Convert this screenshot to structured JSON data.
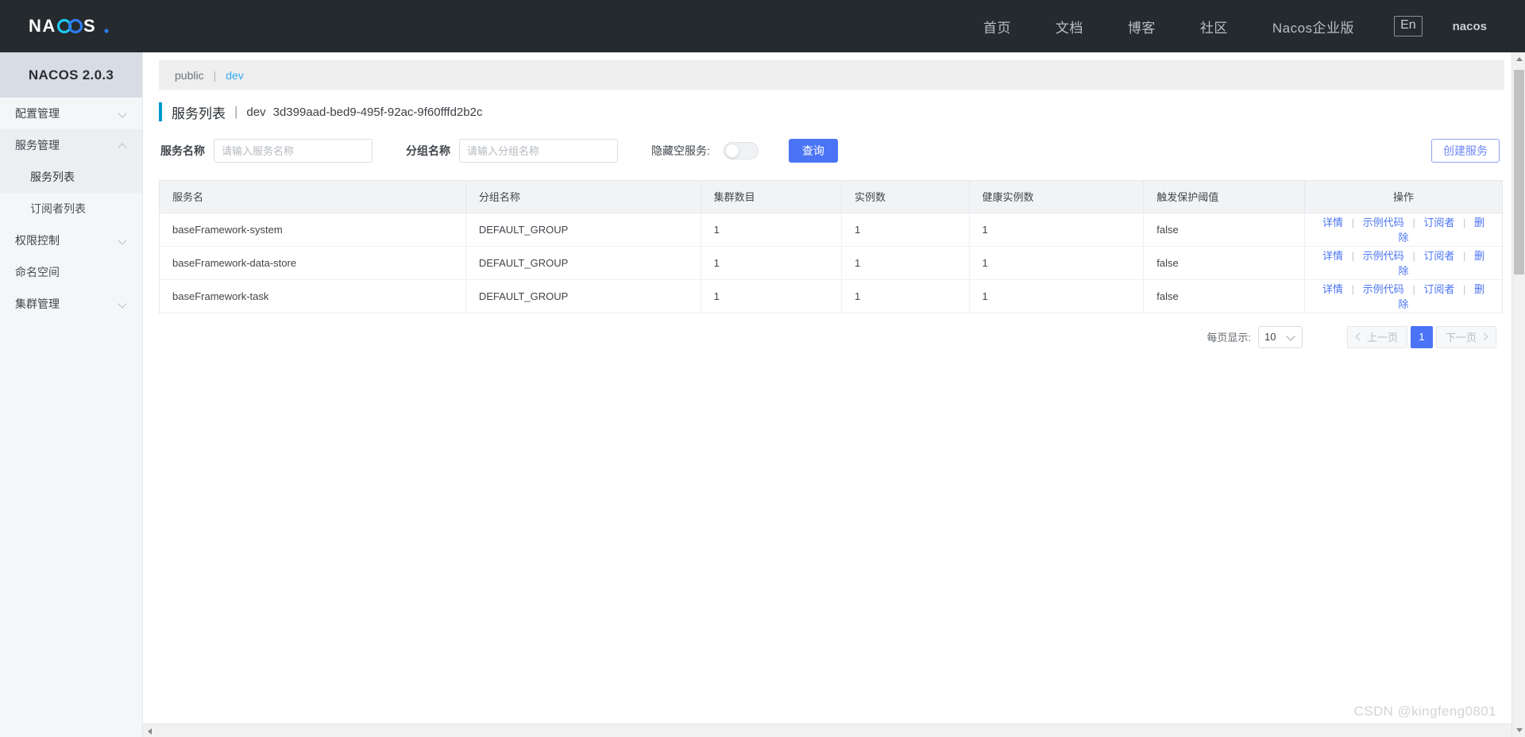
{
  "topnav": {
    "logo_text": "NACOS.",
    "links": [
      {
        "label": "首页"
      },
      {
        "label": "文档"
      },
      {
        "label": "博客"
      },
      {
        "label": "社区"
      },
      {
        "label": "Nacos企业版"
      }
    ],
    "lang_button": "En",
    "user": "nacos"
  },
  "sidebar": {
    "version": "NACOS 2.0.3",
    "items": [
      {
        "label": "配置管理",
        "type": "group",
        "expanded": false
      },
      {
        "label": "服务管理",
        "type": "group",
        "expanded": true
      },
      {
        "label": "服务列表",
        "type": "sub",
        "selected": true
      },
      {
        "label": "订阅者列表",
        "type": "sub",
        "selected": false
      },
      {
        "label": "权限控制",
        "type": "group",
        "expanded": false
      },
      {
        "label": "命名空间",
        "type": "plain"
      },
      {
        "label": "集群管理",
        "type": "group",
        "expanded": false
      }
    ]
  },
  "breadcrumb": {
    "root": "public",
    "separator": "|",
    "current": "dev"
  },
  "page": {
    "title": "服务列表",
    "title_sep": "|",
    "namespace": "dev",
    "namespace_id": "3d399aad-bed9-495f-92ac-9f60fffd2b2c"
  },
  "filters": {
    "service_label": "服务名称",
    "service_placeholder": "请输入服务名称",
    "service_value": "",
    "group_label": "分组名称",
    "group_placeholder": "请输入分组名称",
    "group_value": "",
    "hide_empty_label": "隐藏空服务:",
    "hide_empty_on": false,
    "query_button": "查询",
    "create_button": "创建服务"
  },
  "table": {
    "headers": [
      "服务名",
      "分组名称",
      "集群数目",
      "实例数",
      "健康实例数",
      "触发保护阈值",
      "操作"
    ],
    "actions": [
      "详情",
      "示例代码",
      "订阅者",
      "删除"
    ],
    "action_separator": "|",
    "rows": [
      {
        "name": "baseFramework-system",
        "group": "DEFAULT_GROUP",
        "clusters": "1",
        "instances": "1",
        "healthy": "1",
        "threshold": "false"
      },
      {
        "name": "baseFramework-data-store",
        "group": "DEFAULT_GROUP",
        "clusters": "1",
        "instances": "1",
        "healthy": "1",
        "threshold": "false"
      },
      {
        "name": "baseFramework-task",
        "group": "DEFAULT_GROUP",
        "clusters": "1",
        "instances": "1",
        "healthy": "1",
        "threshold": "false"
      }
    ]
  },
  "pagination": {
    "page_size_label": "每页显示:",
    "page_size": "10",
    "prev": "上一页",
    "next": "下一页",
    "current_page": "1"
  },
  "watermark": "CSDN @kingfeng0801",
  "colors": {
    "nav_bg": "#252a2e",
    "accent_blue": "#4a74f5",
    "link_blue": "#33aaf0",
    "title_bar": "#0099cc"
  }
}
